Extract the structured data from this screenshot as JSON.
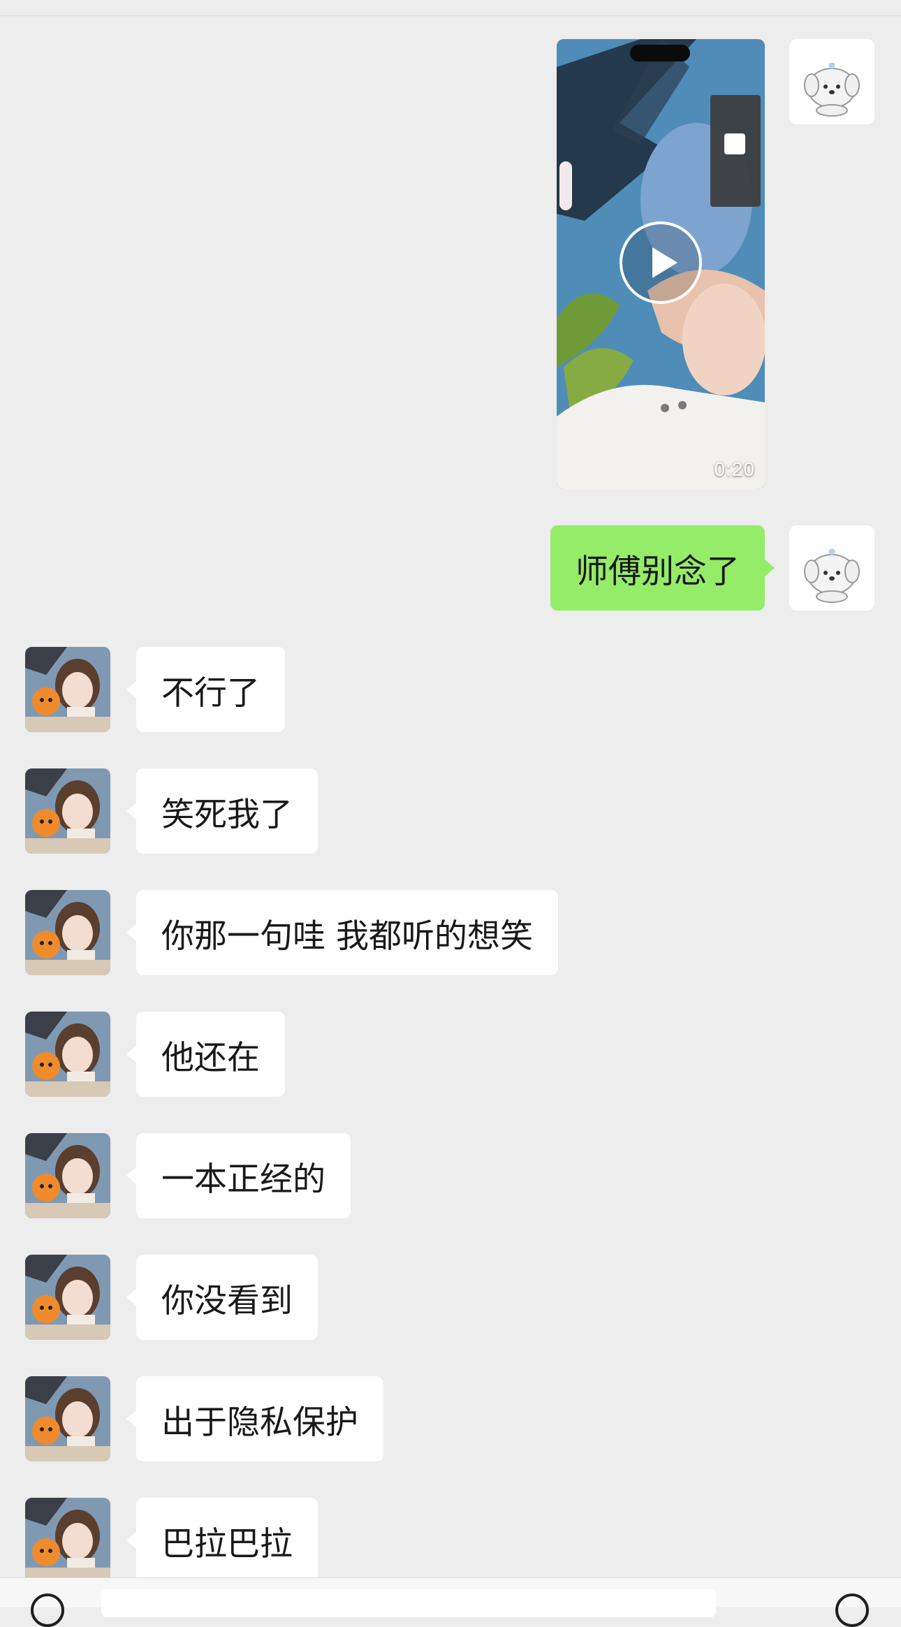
{
  "video": {
    "duration": "0:20"
  },
  "sent_message": "师傅别念了",
  "received_messages": [
    "不行了",
    "笑死我了",
    "你那一句哇 我都听的想笑",
    "他还在",
    "一本正经的",
    "你没看到",
    "出于隐私保护",
    "巴拉巴拉"
  ],
  "colors": {
    "chat_background": "#ededed",
    "outgoing_bubble": "#95ec69",
    "incoming_bubble": "#ffffff",
    "text": "#191919"
  },
  "icons": {
    "video_play": "play-circle-icon",
    "self_avatar": "white-puppy-avatar",
    "friend_avatar": "girl-with-pumpkin-avatar",
    "input_left": "voice-icon",
    "input_right": "plus-icon"
  }
}
